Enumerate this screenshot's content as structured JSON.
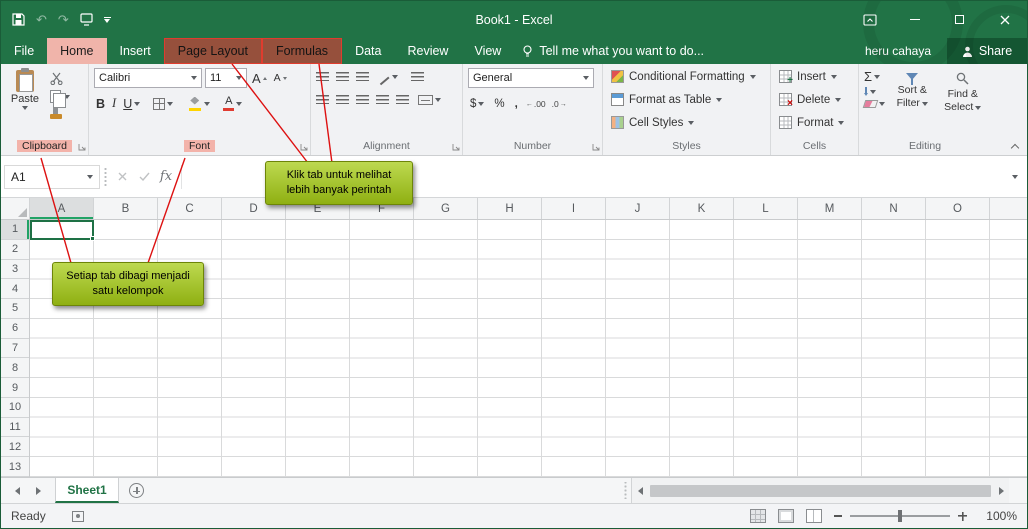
{
  "titlebar": {
    "title": "Book1 - Excel"
  },
  "tabrow": {
    "file": "File",
    "home": "Home",
    "insert": "Insert",
    "page_layout": "Page Layout",
    "formulas": "Formulas",
    "data": "Data",
    "review": "Review",
    "view": "View",
    "tell_me": "Tell me what you want to do...",
    "username": "heru cahaya",
    "share": "Share"
  },
  "icons": {
    "undo": "↶",
    "redo": "↷"
  },
  "ribbon": {
    "clipboard": {
      "label": "Clipboard",
      "paste": "Paste"
    },
    "font": {
      "label": "Font",
      "family": "Calibri",
      "size": "11",
      "bold": "B",
      "italic": "I",
      "underline": "U",
      "grow": "A",
      "shrink": "A",
      "color": "A"
    },
    "alignment": {
      "label": "Alignment"
    },
    "number": {
      "label": "Number",
      "format": "General",
      "currency": "$",
      "percent": "%",
      "comma": ",",
      "inc_decimal": ".00",
      "dec_decimal": ".0"
    },
    "styles": {
      "label": "Styles",
      "conditional": "Conditional Formatting",
      "format_table": "Format as Table",
      "cell_styles": "Cell Styles"
    },
    "cells": {
      "label": "Cells",
      "insert": "Insert",
      "delete": "Delete",
      "format": "Format"
    },
    "editing": {
      "label": "Editing",
      "autosum": "Σ",
      "sort1": "Sort &",
      "sort2": "Filter",
      "find1": "Find &",
      "find2": "Select"
    }
  },
  "formula_bar": {
    "name_box": "A1",
    "fx": "fx",
    "value": ""
  },
  "grid": {
    "columns": [
      "A",
      "B",
      "C",
      "D",
      "E",
      "F",
      "G",
      "H",
      "I",
      "J",
      "K",
      "L",
      "M",
      "N",
      "O"
    ],
    "rows": [
      "1",
      "2",
      "3",
      "4",
      "5",
      "6",
      "7",
      "8",
      "9",
      "10",
      "11",
      "12",
      "13"
    ],
    "selected": "A1"
  },
  "annotations": {
    "tabs_callout": "Klik tab untuk melihat lebih banyak perintah",
    "groups_callout": "Setiap tab dibagi menjadi satu kelompok"
  },
  "sheetbar": {
    "sheet1": "Sheet1"
  },
  "statusbar": {
    "ready": "Ready",
    "zoom": "100%"
  }
}
